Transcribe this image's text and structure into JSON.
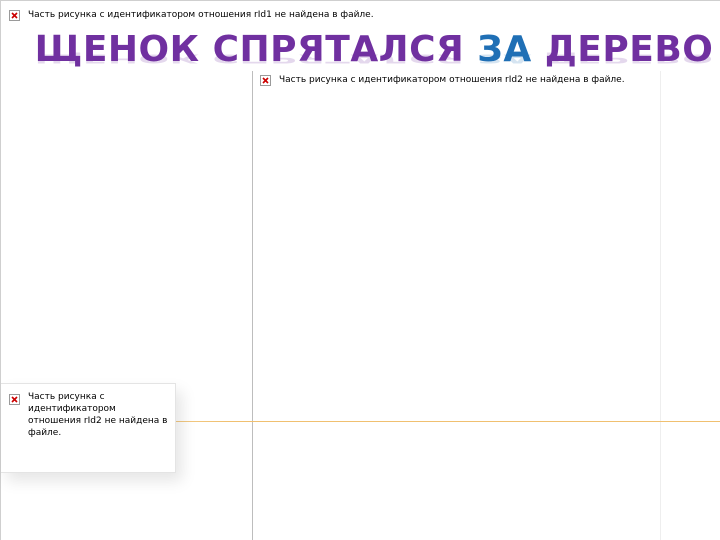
{
  "title": {
    "part1": "ЩЕНОК СПРЯТАЛСЯ ",
    "part2": "ЗА",
    "part3": " ДЕРЕВО",
    "color_main": "#7030a0",
    "color_accent": "#1f6fb5"
  },
  "images": [
    {
      "message": "Часть рисунка с идентификатором отношения rId1 не найдена в файле.",
      "icon": "broken-image-icon"
    },
    {
      "message": "Часть рисунка с идентификатором отношения rId2 не найдена в файле.",
      "icon": "broken-image-icon"
    },
    {
      "message": "Часть рисунка с идентификатором отношения rId2 не найдена в файле.",
      "icon": "broken-image-icon"
    }
  ],
  "accent_line_color": "#f0c070"
}
